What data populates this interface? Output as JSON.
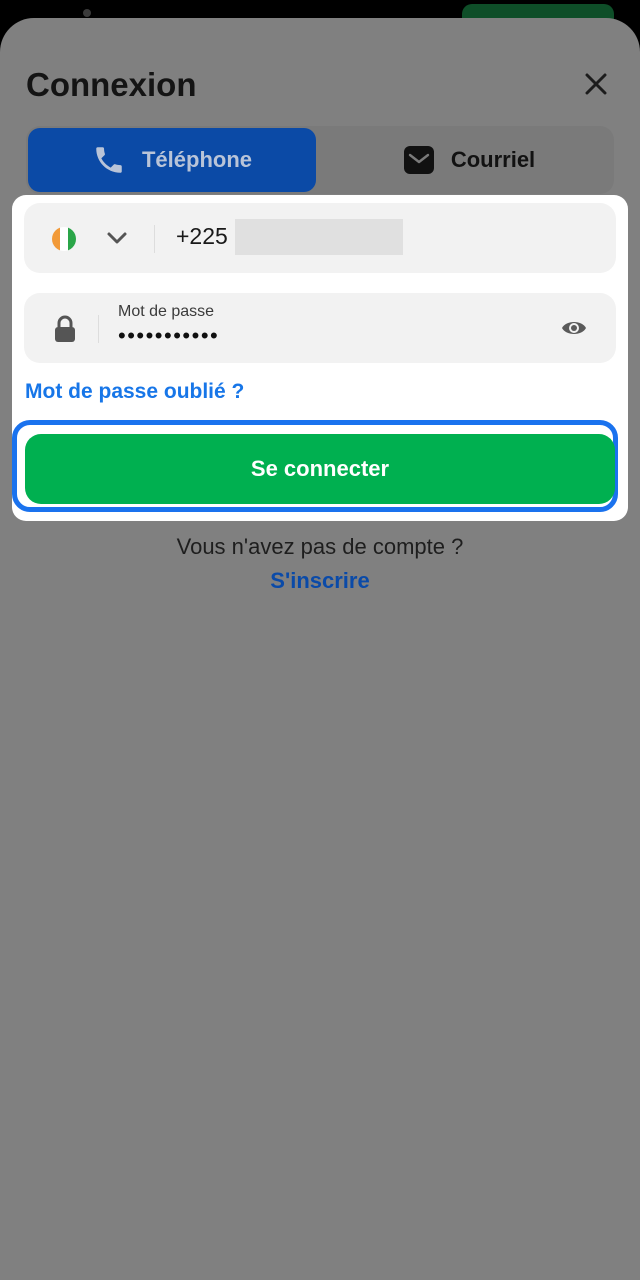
{
  "header": {
    "title": "Connexion",
    "close_icon": "close-icon"
  },
  "tabs": [
    {
      "label": "Téléphone",
      "icon": "phone-icon",
      "selected": true
    },
    {
      "label": "Courriel",
      "icon": "mail-icon",
      "selected": false
    }
  ],
  "form": {
    "country": {
      "flag": "ci-flag-icon",
      "dropdown_icon": "chevron-down-icon"
    },
    "phone": {
      "prefix": "+225",
      "value_redacted": true
    },
    "password": {
      "label": "Mot de passe",
      "value": "•••••••••••",
      "lock_icon": "lock-icon",
      "toggle_icon": "eye-icon"
    },
    "forgot_link": "Mot de passe oublié ?",
    "submit_label": "Se connecter"
  },
  "footer": {
    "prompt": "Vous n'avez pas de compte ?",
    "signup_link": "S'inscrire"
  },
  "colors": {
    "accent_blue": "#1776e8",
    "primary_green": "#00b050",
    "tab_selected": "#0b4aa6",
    "overlay_gray": "#808080"
  }
}
